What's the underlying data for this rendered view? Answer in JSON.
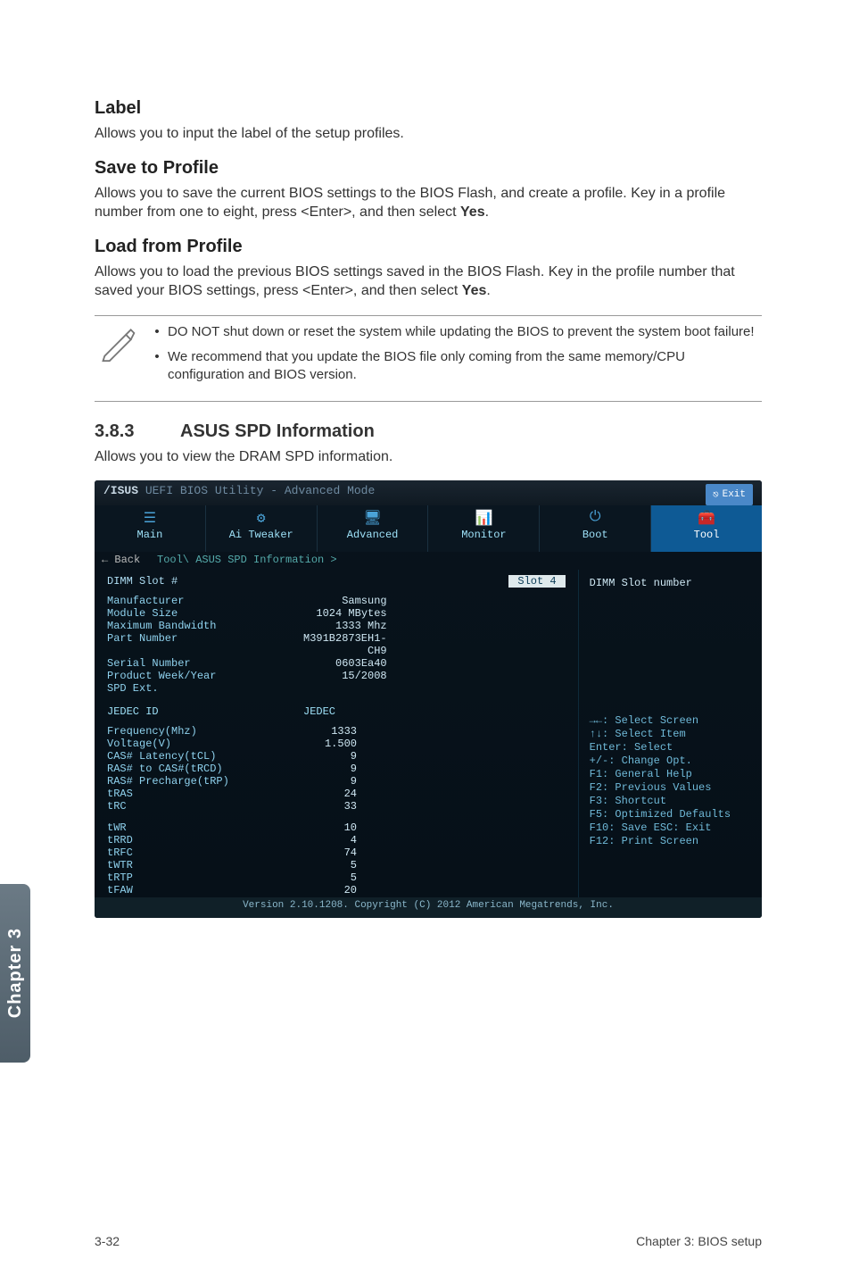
{
  "sections": {
    "label": {
      "title": "Label",
      "body": "Allows you to input the label of the setup profiles."
    },
    "save": {
      "title": "Save to Profile",
      "body_pre": "Allows you to save the current BIOS settings to the BIOS Flash, and create a profile. Key in a profile number from one to eight, press <Enter>, and then select ",
      "body_bold": "Yes",
      "body_post": "."
    },
    "load": {
      "title": "Load from Profile",
      "body_pre": "Allows you to load the previous BIOS settings saved in the BIOS Flash. Key in the profile number that saved your BIOS settings, press <Enter>, and then select ",
      "body_bold": "Yes",
      "body_post": "."
    }
  },
  "notes": {
    "n1": "DO NOT shut down or reset the system while updating the BIOS to prevent the system boot failure!",
    "n2": "We recommend that you update the BIOS file only coming from the same memory/CPU configuration and BIOS version."
  },
  "sub": {
    "num": "3.8.3",
    "title": "ASUS SPD Information",
    "intro": "Allows you to view the DRAM SPD information."
  },
  "bios": {
    "title": "UEFI BIOS Utility - Advanced Mode",
    "exit": "Exit",
    "tabs": {
      "main": "Main",
      "tweaker": "Ai Tweaker",
      "advanced": "Advanced",
      "monitor": "Monitor",
      "boot": "Boot",
      "tool": "Tool"
    },
    "back": "← Back",
    "bread": "Tool\\ ASUS SPD Information >",
    "dimm_label": "DIMM Slot #",
    "dimm_val": "Slot 4",
    "right_hdr": "DIMM Slot number",
    "info": {
      "manufacturer": {
        "lbl": "Manufacturer",
        "val": "Samsung"
      },
      "module": {
        "lbl": "Module Size",
        "val": "1024 MBytes"
      },
      "bandwidth": {
        "lbl": "Maximum Bandwidth",
        "val": "1333 Mhz"
      },
      "part": {
        "lbl": "Part Number",
        "val": "M391B2873EH1-CH9"
      },
      "serial": {
        "lbl": "Serial Number",
        "val": "0603Ea40"
      },
      "week": {
        "lbl": "Product Week/Year",
        "val": "15/2008"
      },
      "spd": {
        "lbl": "SPD Ext.",
        "val": ""
      }
    },
    "jedec": {
      "lbl": "JEDEC ID",
      "col": "JEDEC"
    },
    "rows": {
      "freq": {
        "lbl": "Frequency(Mhz)",
        "val": "1333"
      },
      "volt": {
        "lbl": "Voltage(V)",
        "val": "1.500"
      },
      "cas": {
        "lbl": "CAS# Latency(tCL)",
        "val": "9"
      },
      "rastocas": {
        "lbl": "RAS# to CAS#(tRCD)",
        "val": "9"
      },
      "precharge": {
        "lbl": "RAS# Precharge(tRP)",
        "val": "9"
      },
      "tras": {
        "lbl": "tRAS",
        "val": "24"
      },
      "trc": {
        "lbl": "tRC",
        "val": "33"
      },
      "twr": {
        "lbl": "tWR",
        "val": "10"
      },
      "trrd": {
        "lbl": "tRRD",
        "val": "4"
      },
      "trfc": {
        "lbl": "tRFC",
        "val": "74"
      },
      "twtr": {
        "lbl": "tWTR",
        "val": "5"
      },
      "trtp": {
        "lbl": "tRTP",
        "val": "5"
      },
      "tfaw": {
        "lbl": "tFAW",
        "val": "20"
      }
    },
    "help": {
      "h1": "→←: Select Screen",
      "h2": "↑↓: Select Item",
      "h3": "Enter: Select",
      "h4": "+/-: Change Opt.",
      "h5": "F1: General Help",
      "h6": "F2: Previous Values",
      "h7": "F3: Shortcut",
      "h8": "F5: Optimized Defaults",
      "h9": "F10: Save  ESC: Exit",
      "h10": "F12: Print Screen"
    },
    "footer": "Version 2.10.1208. Copyright (C) 2012 American Megatrends, Inc."
  },
  "side_tab": "Chapter 3",
  "footer": {
    "left": "3-32",
    "right": "Chapter 3: BIOS setup"
  }
}
